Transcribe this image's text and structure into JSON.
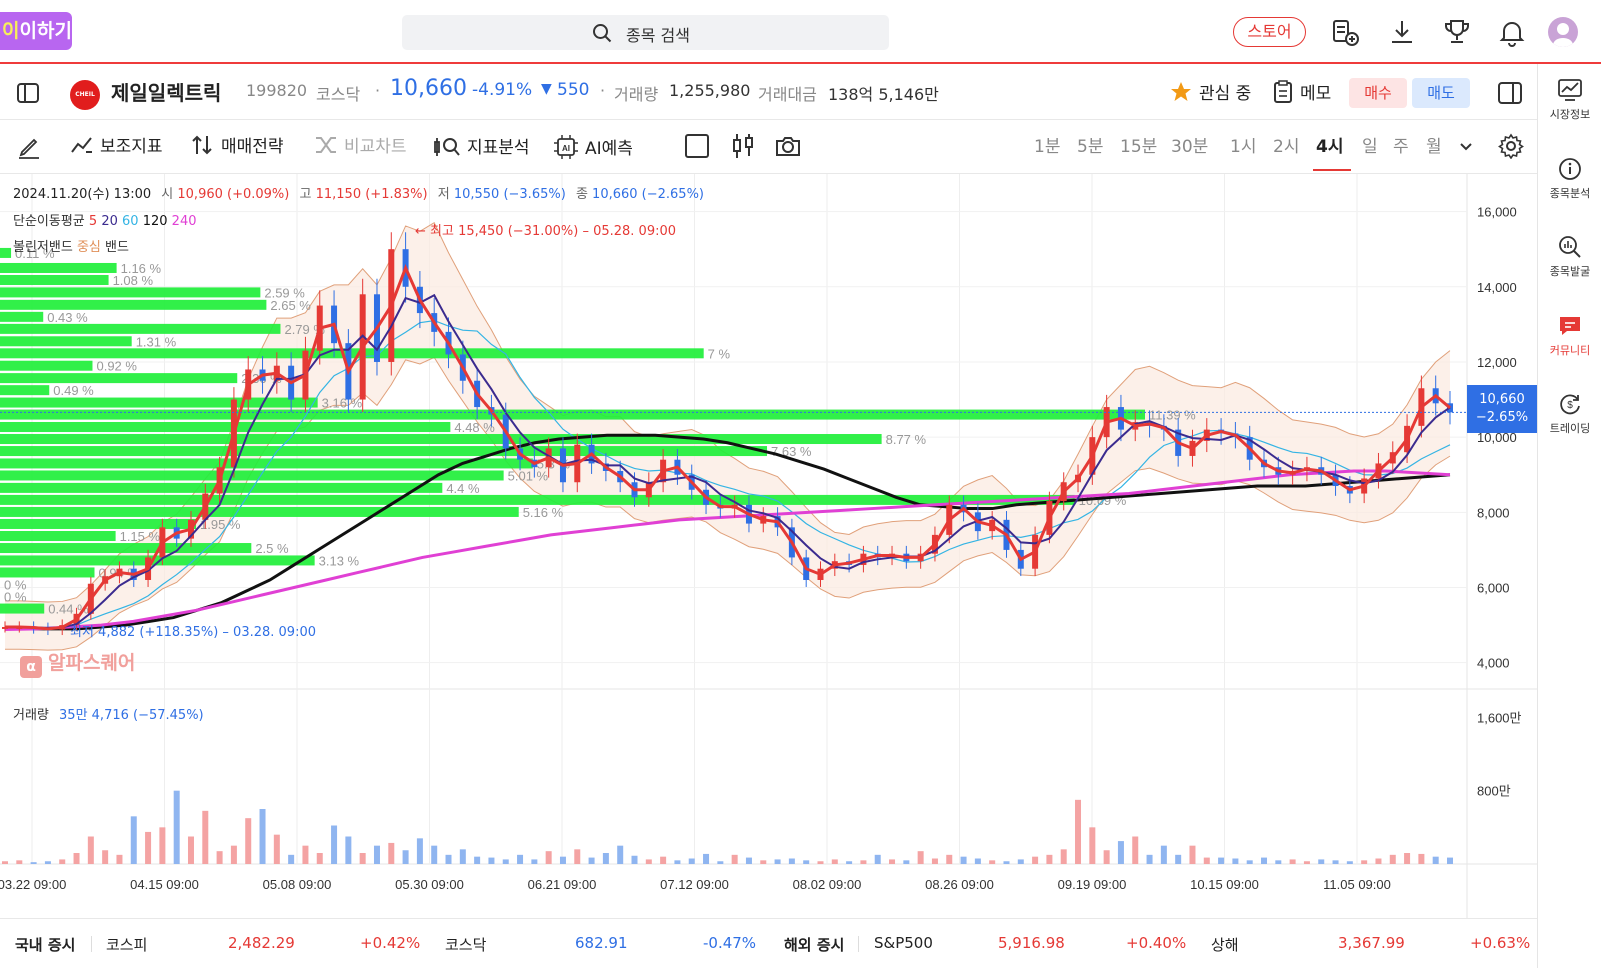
{
  "topbar": {
    "logo_text_a": "이",
    "logo_text_b": "이하기",
    "search_placeholder": "종목 검색",
    "store_label": "스토어",
    "icons": [
      "search-icon",
      "watchlist-add-icon",
      "download-icon",
      "trophy-icon",
      "bell-icon",
      "avatar"
    ]
  },
  "rail": {
    "items": [
      {
        "label": "시장정보",
        "icon": "chart-line-icon"
      },
      {
        "label": "종목분석",
        "icon": "info-icon"
      },
      {
        "label": "종목발굴",
        "icon": "magnify-chart-icon"
      },
      {
        "label": "커뮤니티",
        "icon": "chat-icon"
      },
      {
        "label": "트레이딩",
        "icon": "dollar-cycle-icon"
      }
    ],
    "active_index": 3
  },
  "stock": {
    "logo_text": "CHEIL",
    "name": "제일일렉트릭",
    "code": "199820",
    "market": "코스닥",
    "dot": "·",
    "price": "10,660",
    "change_pct": "-4.91%",
    "change_arrow": "▼",
    "change_amt": "550",
    "volume_label": "거래량",
    "volume": "1,255,980",
    "amount_label": "거래대금",
    "amount": "138억 5,146만",
    "watch_label": "관심 중",
    "memo_label": "메모",
    "buy_label": "매수",
    "sell_label": "매도"
  },
  "toolbar": {
    "tools": [
      "보조지표",
      "매매전략",
      "비교차트",
      "지표분석",
      "AI예측"
    ],
    "periods": [
      "1분",
      "5분",
      "15분",
      "30분",
      "1시",
      "2시",
      "4시",
      "일",
      "주",
      "월"
    ],
    "active_period": "4시"
  },
  "chart": {
    "ohlc": {
      "date": "2024.11.20(수) 13:00",
      "open_label": "시",
      "open": "10,960 (+0.09%)",
      "high_label": "고",
      "high": "11,150 (+1.83%)",
      "low_label": "저",
      "low": "10,550 (−3.65%)",
      "close_label": "종",
      "close": "10,660 (−2.65%)"
    },
    "ma_legend": {
      "label": "단순이동평균",
      "p5": "5",
      "p20": "20",
      "p60": "60",
      "p120": "120",
      "p240": "240"
    },
    "bb_legend": {
      "label": "볼린저밴드",
      "mid": "중심",
      "band": "밴드"
    },
    "max_annotation": "최고 15,450 (−31.00%) – 05.28. 09:00",
    "min_annotation": "최저 4,882 (+118.35%) – 03.28. 09:00",
    "watermark": "알파스퀘어",
    "price_label": "10,660",
    "price_pct_label": "−2.65%",
    "volume_label": "거래량",
    "volume_value": "35만 4,716 (−57.45%)"
  },
  "chart_data": {
    "type": "line",
    "title": "",
    "y_ticks": [
      "16,000",
      "14,000",
      "12,000",
      "10,000",
      "8,000",
      "6,000",
      "4,000"
    ],
    "y_tick_values": [
      16000,
      14000,
      12000,
      10000,
      8000,
      6000,
      4000
    ],
    "ylim": [
      3300,
      17000
    ],
    "vol_ticks": [
      "1,600만",
      "800만"
    ],
    "vol_tick_values": [
      16000000,
      8000000
    ],
    "x_ticks": [
      "03.22 09:00",
      "04.15 09:00",
      "05.08 09:00",
      "05.30 09:00",
      "06.21 09:00",
      "07.12 09:00",
      "08.02 09:00",
      "08.26 09:00",
      "09.19 09:00",
      "10.15 09:00",
      "11.05 09:00"
    ],
    "close_series": {
      "name": "종가",
      "values": [
        4950,
        4950,
        4920,
        4882,
        5000,
        5300,
        6100,
        6300,
        6500,
        6200,
        6800,
        7600,
        7300,
        7800,
        8500,
        9200,
        11000,
        11800,
        11500,
        11900,
        11000,
        12300,
        13500,
        12500,
        11000,
        13800,
        12000,
        15000,
        14000,
        13300,
        12800,
        12200,
        11500,
        10800,
        10600,
        9700,
        9400,
        9200,
        9700,
        8800,
        9800,
        9300,
        9100,
        8800,
        8400,
        8800,
        9400,
        9000,
        8600,
        8200,
        8100,
        8200,
        7700,
        7900,
        7600,
        6800,
        6200,
        6500,
        6700,
        6600,
        6900,
        6800,
        6900,
        6700,
        6900,
        7400,
        8200,
        8000,
        7500,
        7800,
        7000,
        6500,
        7400,
        8300,
        8800,
        9000,
        10000,
        10800,
        10200,
        10400,
        10300,
        10200,
        9500,
        9900,
        10200,
        10100,
        10000,
        9400,
        9200,
        9000,
        9100,
        9200,
        9000,
        8700,
        8500,
        8900,
        9300,
        9600,
        10300,
        11300,
        10900,
        10660
      ]
    },
    "volume_series": {
      "name": "거래량",
      "values": [
        0.3,
        0.4,
        0.2,
        0.3,
        0.5,
        1.2,
        3.0,
        1.5,
        1.0,
        5.2,
        3.5,
        4.0,
        8.0,
        3.0,
        5.8,
        1.4,
        2.0,
        5.0,
        6.0,
        3.2,
        1.0,
        2.0,
        1.2,
        4.2,
        3.0,
        1.2,
        2.0,
        2.3,
        1.5,
        2.8,
        2.0,
        1.0,
        1.6,
        0.8,
        0.7,
        0.5,
        1.0,
        0.5,
        1.4,
        0.8,
        1.6,
        0.7,
        1.2,
        2.0,
        0.9,
        0.5,
        0.8,
        0.4,
        0.6,
        1.1,
        0.3,
        1.0,
        0.7,
        0.4,
        0.5,
        0.6,
        0.4,
        0.3,
        0.5,
        0.3,
        0.4,
        1.0,
        0.5,
        0.4,
        1.4,
        0.6,
        1.0,
        0.8,
        0.6,
        0.4,
        0.3,
        0.5,
        0.8,
        1.0,
        1.6,
        7.0,
        4.0,
        1.5,
        2.5,
        3.0,
        1.0,
        2.0,
        1.0,
        2.0,
        0.7,
        0.7,
        0.6,
        0.4,
        0.7,
        0.4,
        0.5,
        0.3,
        0.5,
        0.4,
        0.3,
        0.4,
        0.6,
        1.0,
        1.2,
        1.1,
        0.8,
        0.7
      ]
    },
    "ma120": [
      4900,
      4900,
      4900,
      4900,
      4950,
      5000,
      5100,
      5200,
      5400,
      5600,
      5900,
      6200,
      6600,
      7000,
      7400,
      7800,
      8200,
      8600,
      9000,
      9300,
      9500,
      9700,
      9850,
      9950,
      10000,
      10050,
      10050,
      10050,
      10000,
      9950,
      9850,
      9700,
      9550,
      9350,
      9150,
      8900,
      8650,
      8400,
      8200,
      8150,
      8100,
      8100,
      8200,
      8250,
      8300,
      8350,
      8400,
      8450,
      8500,
      8550,
      8600,
      8650,
      8700,
      8700,
      8700,
      8750,
      8800,
      8850,
      8900,
      8950,
      9000
    ],
    "ma240": [
      4882,
      4900,
      4950,
      5000,
      5100,
      5250,
      5400,
      5600,
      5800,
      6000,
      6200,
      6400,
      6600,
      6800,
      6950,
      7100,
      7250,
      7400,
      7500,
      7600,
      7700,
      7800,
      7850,
      7900,
      7950,
      8000,
      8050,
      8100,
      8150,
      8200,
      8250,
      8300,
      8350,
      8400,
      8450,
      8500,
      8600,
      8700,
      8800,
      8900,
      9000,
      9050,
      9100,
      9100,
      9050,
      9000
    ],
    "volume_profile": [
      {
        "price": 14900,
        "pct": "0.11 %",
        "len": 0.11
      },
      {
        "price": 14500,
        "pct": "1.16 %",
        "len": 1.16
      },
      {
        "price": 14180,
        "pct": "1.08 %",
        "len": 1.08
      },
      {
        "price": 13850,
        "pct": "2.59 %",
        "len": 2.59
      },
      {
        "price": 13520,
        "pct": "2.65 %",
        "len": 2.65
      },
      {
        "price": 13200,
        "pct": "0.43 %",
        "len": 0.43
      },
      {
        "price": 12880,
        "pct": "2.79 %",
        "len": 2.79
      },
      {
        "price": 12550,
        "pct": "1.31 %",
        "len": 1.31
      },
      {
        "price": 12230,
        "pct": "7 %",
        "len": 7.0
      },
      {
        "price": 11900,
        "pct": "0.92 %",
        "len": 0.92
      },
      {
        "price": 11570,
        "pct": "2.36 %",
        "len": 2.36
      },
      {
        "price": 11250,
        "pct": "0.49 %",
        "len": 0.49
      },
      {
        "price": 10920,
        "pct": "3.16 %",
        "len": 3.16
      },
      {
        "price": 10600,
        "pct": "11.39 %",
        "len": 11.39
      },
      {
        "price": 10270,
        "pct": "4.48 %",
        "len": 4.48
      },
      {
        "price": 9950,
        "pct": "8.77 %",
        "len": 8.77
      },
      {
        "price": 9630,
        "pct": "7.63 %",
        "len": 7.63
      },
      {
        "price": 9300,
        "pct": "5.3 %",
        "len": 5.3
      },
      {
        "price": 8980,
        "pct": "5.01 %",
        "len": 5.01
      },
      {
        "price": 8650,
        "pct": "4.4 %",
        "len": 4.4
      },
      {
        "price": 8330,
        "pct": "10.69 %",
        "len": 10.69
      },
      {
        "price": 8010,
        "pct": "5.16 %",
        "len": 5.16
      },
      {
        "price": 7690,
        "pct": "1.95 %",
        "len": 1.95
      },
      {
        "price": 7370,
        "pct": "1.15 %",
        "len": 1.15
      },
      {
        "price": 7050,
        "pct": "2.5 %",
        "len": 2.5
      },
      {
        "price": 6720,
        "pct": "3.13 %",
        "len": 3.13
      },
      {
        "price": 6400,
        "pct": "0.94 %",
        "len": 0.94
      },
      {
        "price": 6080,
        "pct": "0 %",
        "len": 0.0
      },
      {
        "price": 5760,
        "pct": "0 %",
        "len": 0.0
      },
      {
        "price": 5440,
        "pct": "0.44 %",
        "len": 0.44
      }
    ],
    "grid": true
  },
  "footer": {
    "domestic_label": "국내 증시",
    "kospi_label": "코스피",
    "kospi": "2,482.29",
    "kospi_chg": "+0.42%",
    "kosdaq_label": "코스닥",
    "kosdaq": "682.91",
    "kosdaq_chg": "-0.47%",
    "overseas_label": "해외 증시",
    "sp_label": "S&P500",
    "sp": "5,916.98",
    "sp_chg": "+0.40%",
    "sh_label": "상해",
    "sh": "3,367.99",
    "sh_chg": "+0.63%"
  },
  "colors": {
    "up": "#e53935",
    "down": "#2f6fe4",
    "profile": "#1fef3a",
    "ma5": "#e53935",
    "ma20": "#3b2b8f",
    "ma60": "#34b4e4",
    "ma120": "#111111",
    "ma240": "#e040d4"
  }
}
